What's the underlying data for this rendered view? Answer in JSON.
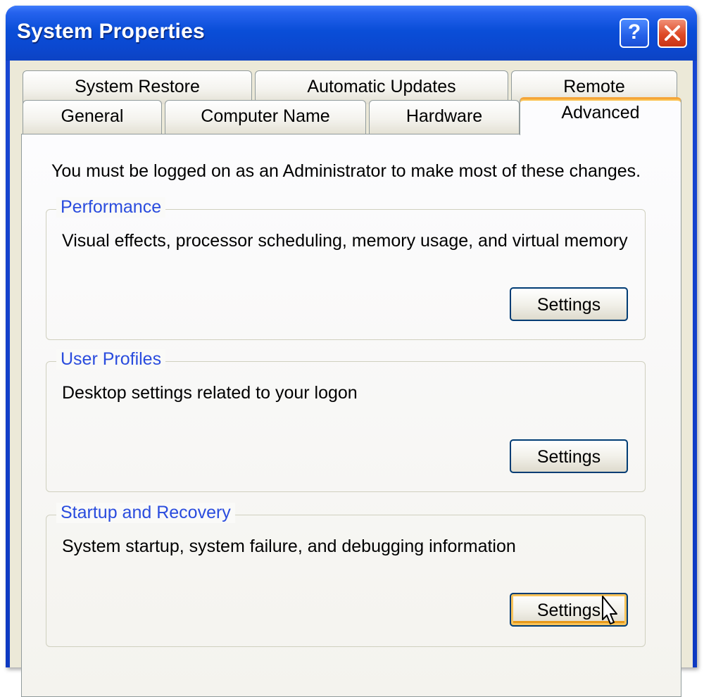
{
  "window": {
    "title": "System Properties",
    "help_label": "?",
    "close_label": "Close"
  },
  "tabs": {
    "row_back": [
      {
        "label": "System Restore"
      },
      {
        "label": "Automatic Updates"
      },
      {
        "label": "Remote"
      }
    ],
    "row_front": [
      {
        "label": "General"
      },
      {
        "label": "Computer Name"
      },
      {
        "label": "Hardware"
      },
      {
        "label": "Advanced",
        "selected": true
      }
    ]
  },
  "advanced": {
    "notice": "You must be logged on as an Administrator to make most of these changes.",
    "groups": [
      {
        "title": "Performance",
        "description": "Visual effects, processor scheduling, memory usage, and virtual memory",
        "button_label": "Settings"
      },
      {
        "title": "User Profiles",
        "description": "Desktop settings related to your logon",
        "button_label": "Settings"
      },
      {
        "title": "Startup and Recovery",
        "description": "System startup, system failure, and debugging information",
        "button_label": "Settings",
        "hovered": true
      }
    ]
  },
  "colors": {
    "title_bar": "#0a4ed8",
    "group_title": "#2a4cde",
    "active_tab_accent": "#f4a53a",
    "close_button": "#de4a27"
  }
}
